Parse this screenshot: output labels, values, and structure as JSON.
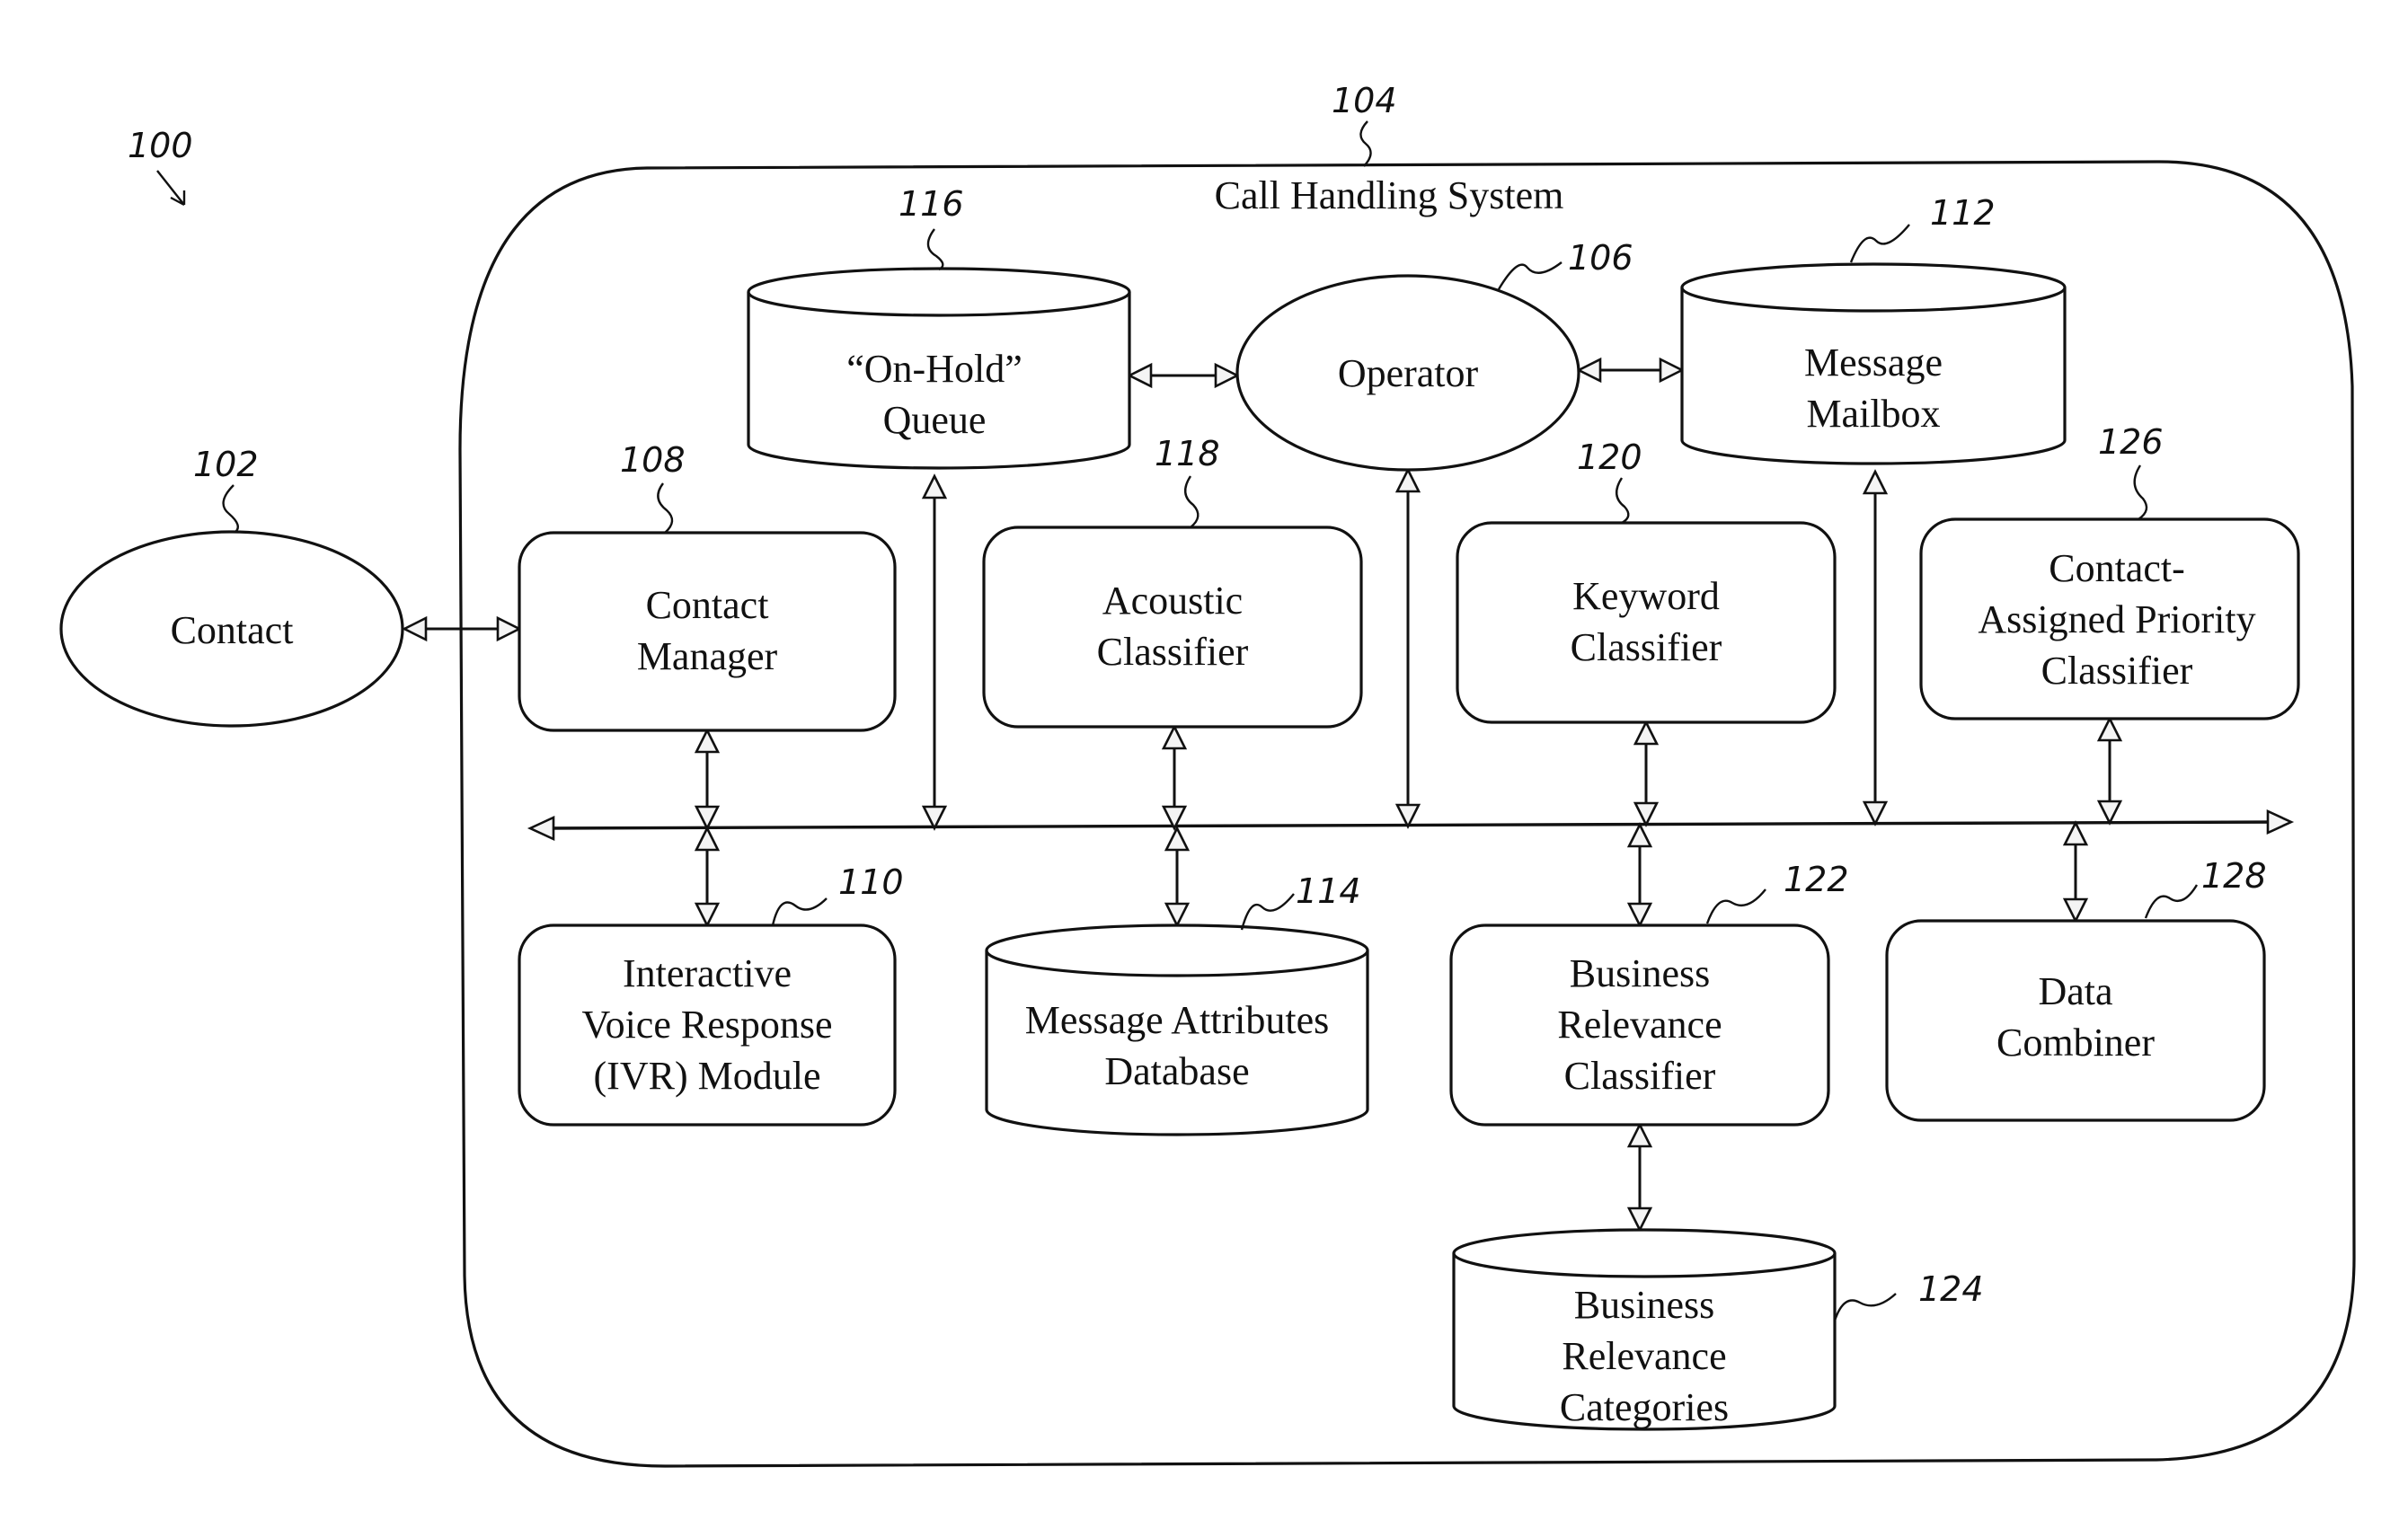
{
  "figure": {
    "figure_ref": "100",
    "system": {
      "ref": "104",
      "title": "Call Handling System"
    }
  },
  "nodes": [
    {
      "id": "contact",
      "ref": "102",
      "shape": "ellipse",
      "lines": [
        "Contact"
      ]
    },
    {
      "id": "operator",
      "ref": "106",
      "shape": "ellipse",
      "lines": [
        "Operator"
      ]
    },
    {
      "id": "contact-manager",
      "ref": "108",
      "shape": "rounded-box",
      "lines": [
        "Contact",
        "Manager"
      ]
    },
    {
      "id": "ivr-module",
      "ref": "110",
      "shape": "rounded-box",
      "lines": [
        "Interactive",
        "Voice Response",
        "(IVR) Module"
      ]
    },
    {
      "id": "message-mailbox",
      "ref": "112",
      "shape": "cylinder",
      "lines": [
        "Message",
        "Mailbox"
      ]
    },
    {
      "id": "message-attributes-database",
      "ref": "114",
      "shape": "cylinder",
      "lines": [
        "Message Attributes",
        "Database"
      ]
    },
    {
      "id": "on-hold-queue",
      "ref": "116",
      "shape": "cylinder",
      "lines": [
        "“On-Hold”",
        "Queue"
      ]
    },
    {
      "id": "acoustic-classifier",
      "ref": "118",
      "shape": "rounded-box",
      "lines": [
        "Acoustic",
        "Classifier"
      ]
    },
    {
      "id": "keyword-classifier",
      "ref": "120",
      "shape": "rounded-box",
      "lines": [
        "Keyword",
        "Classifier"
      ]
    },
    {
      "id": "business-relevance-classifier",
      "ref": "122",
      "shape": "rounded-box",
      "lines": [
        "Business",
        "Relevance",
        "Classifier"
      ]
    },
    {
      "id": "business-relevance-categories",
      "ref": "124",
      "shape": "cylinder",
      "lines": [
        "Business",
        "Relevance",
        "Categories"
      ]
    },
    {
      "id": "contact-assigned-priority-classifier",
      "ref": "126",
      "shape": "rounded-box",
      "lines": [
        "Contact-",
        "Assigned Priority",
        "Classifier"
      ]
    },
    {
      "id": "data-combiner",
      "ref": "128",
      "shape": "rounded-box",
      "lines": [
        "Data",
        "Combiner"
      ]
    }
  ],
  "connections": [
    {
      "from": "contact",
      "to": "contact-manager",
      "bidirectional": true
    },
    {
      "from": "on-hold-queue",
      "to": "operator",
      "bidirectional": true
    },
    {
      "from": "operator",
      "to": "message-mailbox",
      "bidirectional": true
    },
    {
      "from": "contact-manager",
      "to": "bus",
      "bidirectional": true
    },
    {
      "from": "on-hold-queue",
      "to": "bus",
      "bidirectional": true
    },
    {
      "from": "acoustic-classifier",
      "to": "bus",
      "bidirectional": true
    },
    {
      "from": "operator",
      "to": "bus",
      "bidirectional": true
    },
    {
      "from": "keyword-classifier",
      "to": "bus",
      "bidirectional": true
    },
    {
      "from": "message-mailbox",
      "to": "bus",
      "bidirectional": true
    },
    {
      "from": "contact-assigned-priority-classifier",
      "to": "bus",
      "bidirectional": true
    },
    {
      "from": "bus",
      "to": "ivr-module",
      "bidirectional": true
    },
    {
      "from": "bus",
      "to": "message-attributes-database",
      "bidirectional": true
    },
    {
      "from": "bus",
      "to": "business-relevance-classifier",
      "bidirectional": true
    },
    {
      "from": "bus",
      "to": "data-combiner",
      "bidirectional": true
    },
    {
      "from": "business-relevance-classifier",
      "to": "business-relevance-categories",
      "bidirectional": true
    }
  ]
}
